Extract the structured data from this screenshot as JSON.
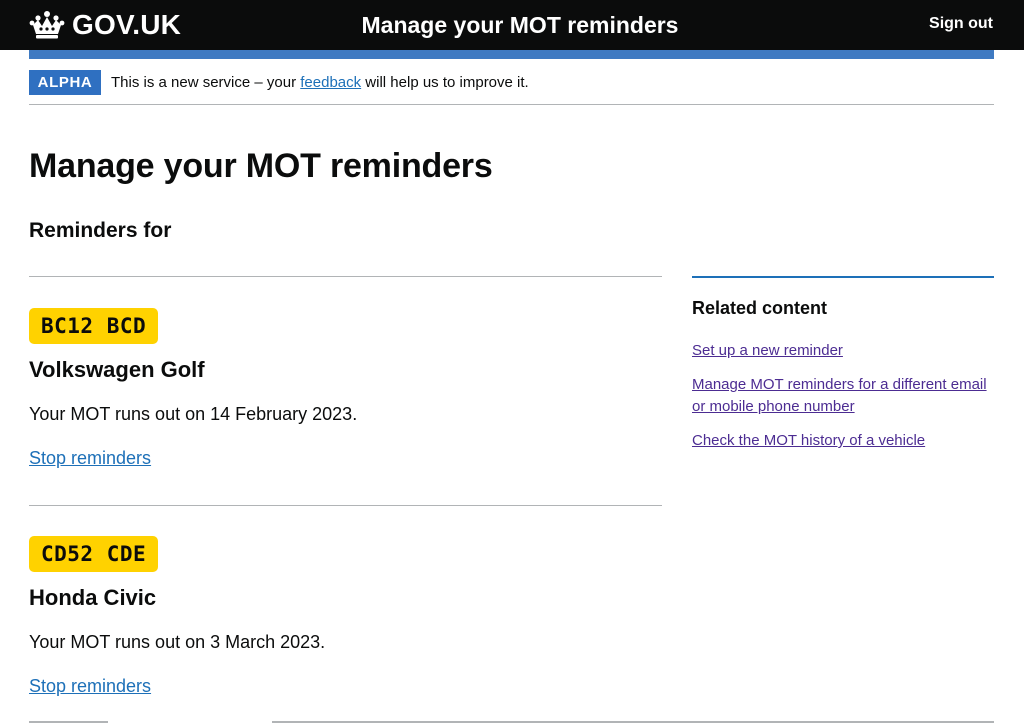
{
  "header": {
    "logo_text": "GOV.UK",
    "service_name": "Manage your MOT reminders",
    "sign_out_label": "Sign out",
    "background_color": "#0b0c0c"
  },
  "phase_banner": {
    "tag": "ALPHA",
    "text_before": "This is a new service – your ",
    "link_text": "feedback",
    "text_after": " will help us to improve it.",
    "tag_color": "#2f70c1"
  },
  "main": {
    "title": "Manage your MOT reminders",
    "subtitle": "Reminders for",
    "vehicles": [
      {
        "plate": "BC12 BCD",
        "name": "Volkswagen Golf",
        "mot_text": "Your MOT runs out on 14 February 2023.",
        "stop_label": "Stop reminders"
      },
      {
        "plate": "CD52 CDE",
        "name": "Honda Civic",
        "mot_text": "Your MOT runs out on 3 March 2023.",
        "stop_label": "Stop reminders"
      }
    ]
  },
  "related": {
    "heading": "Related content",
    "links": [
      "Set up a new reminder",
      "Manage MOT reminders for a different email or mobile phone number",
      "Check the MOT history of a vehicle"
    ]
  },
  "colors": {
    "link": "#1d70b8",
    "visited_link": "#4c2c92",
    "plate_yellow": "#ffd200",
    "accent_blue": "#3f7ac2"
  }
}
